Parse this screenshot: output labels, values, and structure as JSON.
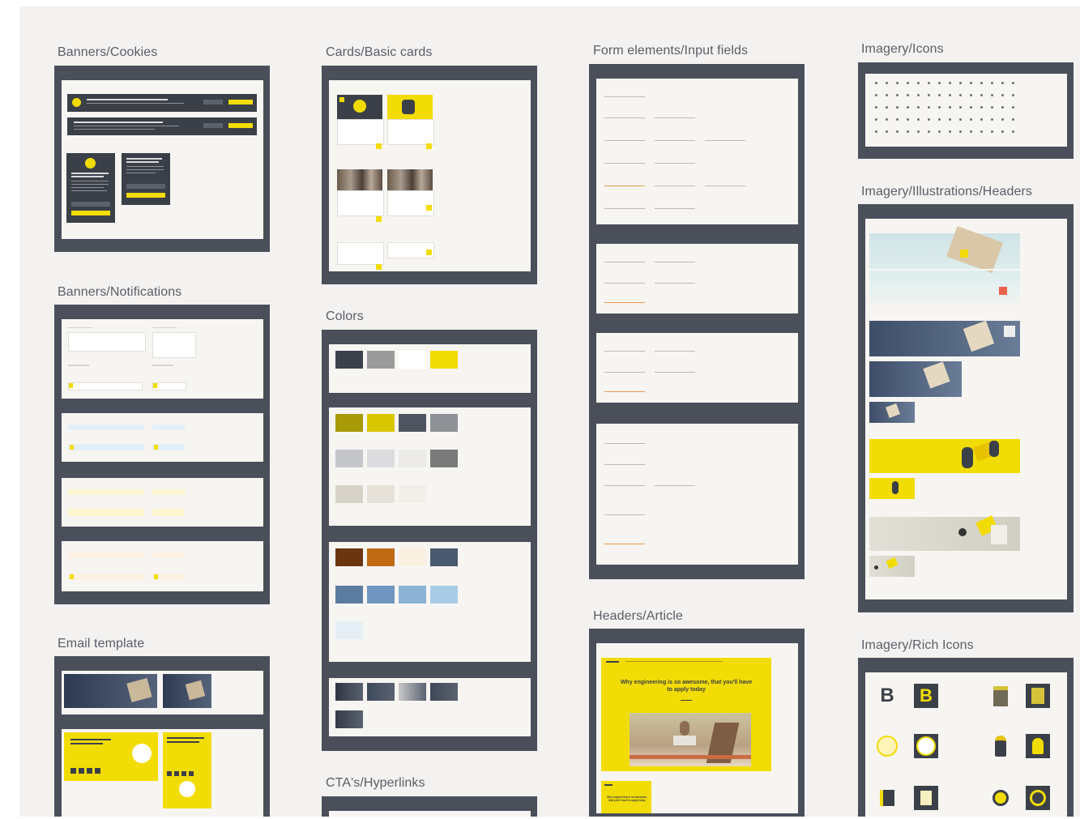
{
  "frames": {
    "banners_cookies": {
      "title": "Banners/Cookies"
    },
    "banners_notifications": {
      "title": "Banners/Notifications"
    },
    "email_template": {
      "title": "Email template"
    },
    "cards_basic": {
      "title": "Cards/Basic cards"
    },
    "colors": {
      "title": "Colors"
    },
    "ctas": {
      "title": "CTA's/Hyperlinks"
    },
    "form_inputs": {
      "title": "Form elements/Input fields"
    },
    "headers_article": {
      "title": "Headers/Article",
      "headline": "Why engineering is so awesome, that you'll have to apply today",
      "mobile_headline": "Why engineering is so awesome, that you'll have to apply today"
    },
    "imagery_icons": {
      "title": "Imagery/Icons"
    },
    "imagery_illustrations": {
      "title": "Imagery/Illustrations/Headers"
    },
    "imagery_rich_icons": {
      "title": "Imagery/Rich Icons"
    }
  },
  "colors": {
    "canvas": "#f3f2f1",
    "frame": "#4a4f5a",
    "panel": "#f7f5f2",
    "accent": "#f2dc05",
    "swatches_main": [
      "#3b414b",
      "#9b9b9b",
      "#ffffff",
      "#f2dc05"
    ],
    "swatches_secondary": [
      "#a89a08",
      "#d8c700",
      "#4e5560",
      "#8e9196",
      "#c5c6ca",
      "#dcdcde",
      "#ecebea",
      "#7a7a7a",
      "#d6d2c8",
      "#e6e2da",
      "#f2efe9"
    ],
    "swatches_tertiary": [
      "#6b3510",
      "#c06a14",
      "#faf0e2",
      "#4a5a6e",
      "#5b7ba0",
      "#7096c0",
      "#8cb3d6",
      "#a9cce6",
      "#e5eef5"
    ],
    "swatches_gradients": [
      "#2f3540",
      "#3e4a5c",
      "#c8c8c8",
      "#3f4857",
      "#353b46"
    ]
  }
}
